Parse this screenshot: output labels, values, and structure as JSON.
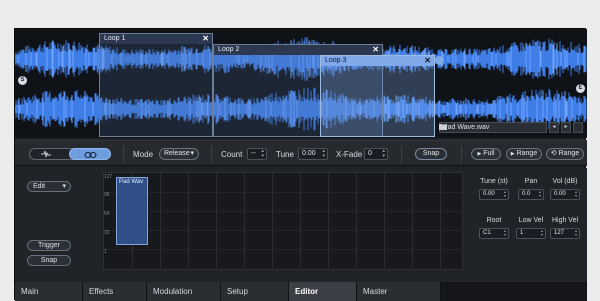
{
  "waveform": {
    "loops": [
      {
        "label": "Loop 1"
      },
      {
        "label": "Loop 2"
      },
      {
        "label": "Loop 3",
        "active": true
      }
    ],
    "close_glyph": "✕",
    "start_marker": "S",
    "end_marker": "E",
    "file": {
      "name": "Pad Wave.wav",
      "prev_glyph": "◂",
      "next_glyph": "▸",
      "folder_icon": "folder-icon"
    },
    "colors": {
      "wave": "#3e7ee6",
      "wave_highlight": "#6ea3ff",
      "background": "#0f1216"
    }
  },
  "controls": {
    "mode_label": "Mode",
    "mode_value": "Release",
    "count_label": "Count",
    "count_value": "--",
    "tune_label": "Tune",
    "tune_value": "0.00",
    "xfade_label": "X-Fade",
    "xfade_value": "0",
    "snap_label": "Snap",
    "full_label": "Full",
    "range1_label": "Range",
    "range2_label": "Range",
    "play_glyph": "▶",
    "loop_glyph": "⟲",
    "chevron": "▾"
  },
  "editor": {
    "edit_label": "Edit",
    "trigger_label": "Trigger",
    "snap_label": "Snap",
    "zone_label": "Pad Wav",
    "axis_labels": [
      "127",
      "96",
      "64",
      "32",
      "1"
    ],
    "params_top": [
      {
        "label": "Tune (st)",
        "value": "0.00"
      },
      {
        "label": "Pan",
        "value": "0.0"
      },
      {
        "label": "Vol (dB)",
        "value": "0.00"
      }
    ],
    "params_bottom": [
      {
        "label": "Root",
        "value": "C1"
      },
      {
        "label": "Low Vel",
        "value": "1"
      },
      {
        "label": "High Vel",
        "value": "127"
      }
    ]
  },
  "tabs": [
    {
      "label": "Main"
    },
    {
      "label": "Effects"
    },
    {
      "label": "Modulation"
    },
    {
      "label": "Setup"
    },
    {
      "label": "Editor",
      "active": true
    },
    {
      "label": "Master"
    }
  ]
}
